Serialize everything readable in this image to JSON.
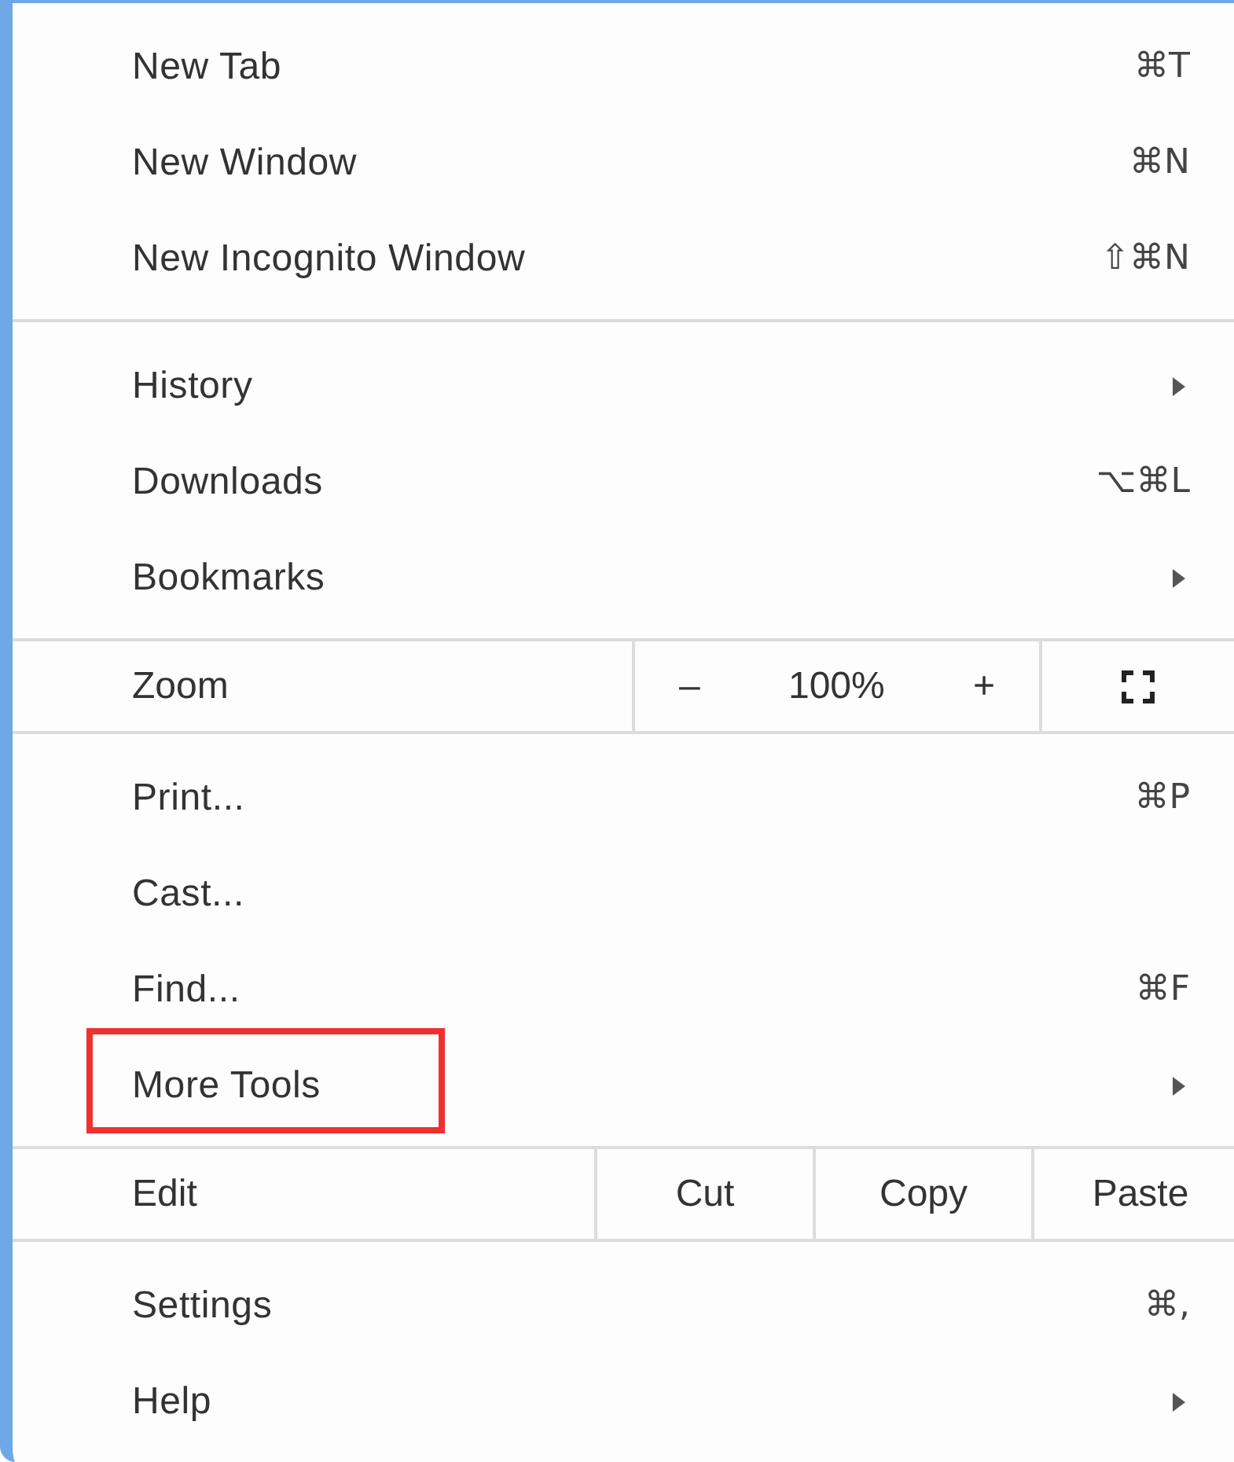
{
  "menu": {
    "sections": [
      {
        "kind": "items",
        "items": [
          {
            "label": "New Tab",
            "shortcut": "⌘T",
            "submenu": false,
            "highlighted": false
          },
          {
            "label": "New Window",
            "shortcut": "⌘N",
            "submenu": false,
            "highlighted": false
          },
          {
            "label": "New Incognito Window",
            "shortcut": "⇧⌘N",
            "submenu": false,
            "highlighted": false
          }
        ]
      },
      {
        "kind": "items",
        "items": [
          {
            "label": "History",
            "submenu": true,
            "highlighted": false
          },
          {
            "label": "Downloads",
            "shortcut": "⌥⌘L",
            "submenu": false,
            "highlighted": false
          },
          {
            "label": "Bookmarks",
            "submenu": true,
            "highlighted": false
          }
        ]
      },
      {
        "kind": "zoom",
        "label": "Zoom",
        "decrease": "–",
        "value": "100%",
        "increase": "+"
      },
      {
        "kind": "items",
        "items": [
          {
            "label": "Print...",
            "shortcut": "⌘P",
            "submenu": false,
            "highlighted": false
          },
          {
            "label": "Cast...",
            "submenu": false,
            "highlighted": false
          },
          {
            "label": "Find...",
            "shortcut": "⌘F",
            "submenu": false,
            "highlighted": false
          },
          {
            "label": "More Tools",
            "submenu": true,
            "highlighted": true
          }
        ]
      },
      {
        "kind": "edit",
        "label": "Edit",
        "actions": [
          "Cut",
          "Copy",
          "Paste"
        ]
      },
      {
        "kind": "items",
        "items": [
          {
            "label": "Settings",
            "shortcut": "⌘,",
            "submenu": false,
            "highlighted": false
          },
          {
            "label": "Help",
            "submenu": true,
            "highlighted": false
          }
        ]
      }
    ]
  }
}
